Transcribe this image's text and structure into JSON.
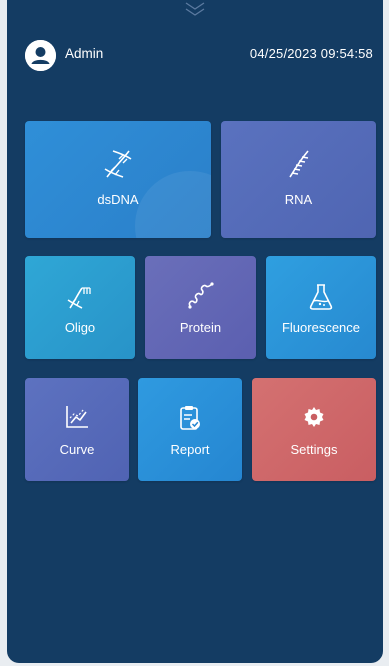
{
  "header": {
    "user_icon": "user-avatar-icon",
    "user_name": "Admin",
    "datetime": "04/25/2023 09:54:58"
  },
  "tiles": [
    {
      "label": "dsDNA",
      "icon": "dna-double-helix-icon",
      "color": "#2f8fd8"
    },
    {
      "label": "RNA",
      "icon": "rna-strand-icon",
      "color": "#5a72bf"
    },
    {
      "label": "Oligo",
      "icon": "oligo-icon",
      "color": "#2fa7d6"
    },
    {
      "label": "Protein",
      "icon": "protein-icon",
      "color": "#6a6fba"
    },
    {
      "label": "Fluorescence",
      "icon": "flask-icon",
      "color": "#2f9fe0"
    },
    {
      "label": "Curve",
      "icon": "line-chart-icon",
      "color": "#5d72c0"
    },
    {
      "label": "Report",
      "icon": "clipboard-check-icon",
      "color": "#2f9ae0"
    },
    {
      "label": "Settings",
      "icon": "gear-icon",
      "color": "#d47171"
    }
  ],
  "colors": {
    "background": "#143c63",
    "text": "#ffffff"
  }
}
